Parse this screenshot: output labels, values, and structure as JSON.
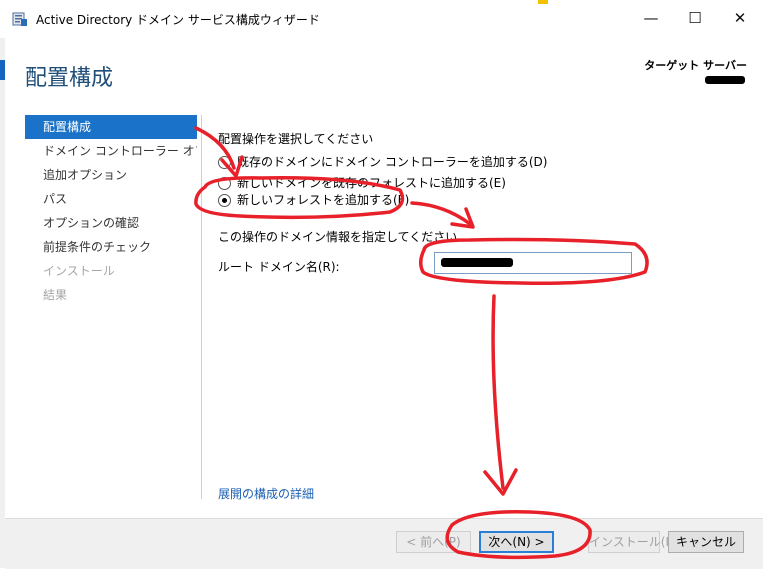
{
  "window": {
    "title": "Active Directory ドメイン サービス構成ウィザード",
    "controls": {
      "minimize": "—",
      "maximize": "☐",
      "close": "✕"
    }
  },
  "header": {
    "page_title": "配置構成",
    "target_label": "ターゲット サーバー"
  },
  "nav": {
    "items": [
      {
        "label": "配置構成",
        "state": "active"
      },
      {
        "label": "ドメイン コントローラー オプシ...",
        "state": "normal"
      },
      {
        "label": "追加オプション",
        "state": "normal"
      },
      {
        "label": "パス",
        "state": "normal"
      },
      {
        "label": "オプションの確認",
        "state": "normal"
      },
      {
        "label": "前提条件のチェック",
        "state": "normal"
      },
      {
        "label": "インストール",
        "state": "disabled"
      },
      {
        "label": "結果",
        "state": "disabled"
      }
    ]
  },
  "main": {
    "select_operation_label": "配置操作を選択してください",
    "options": [
      {
        "label": "既存のドメインにドメイン コントローラーを追加する(D)",
        "checked": false
      },
      {
        "label": "新しいドメインを既存のフォレストに追加する(E)",
        "checked": false
      },
      {
        "label": "新しいフォレストを追加する(F)",
        "checked": true
      }
    ],
    "domain_info_label": "この操作のドメイン情報を指定してください",
    "root_domain_label": "ルート ドメイン名(R):",
    "details_link": "展開の構成の詳細"
  },
  "footer": {
    "prev": "< 前へ(P)",
    "next": "次へ(N) >",
    "install": "インストール(I)",
    "cancel": "キャンセル"
  },
  "colors": {
    "accent": "#1a73c9",
    "title": "#1f4e79",
    "annotation": "#e8202a",
    "link": "#1a5fb4"
  },
  "icons": {
    "app": "ad-ds-wizard-icon"
  }
}
